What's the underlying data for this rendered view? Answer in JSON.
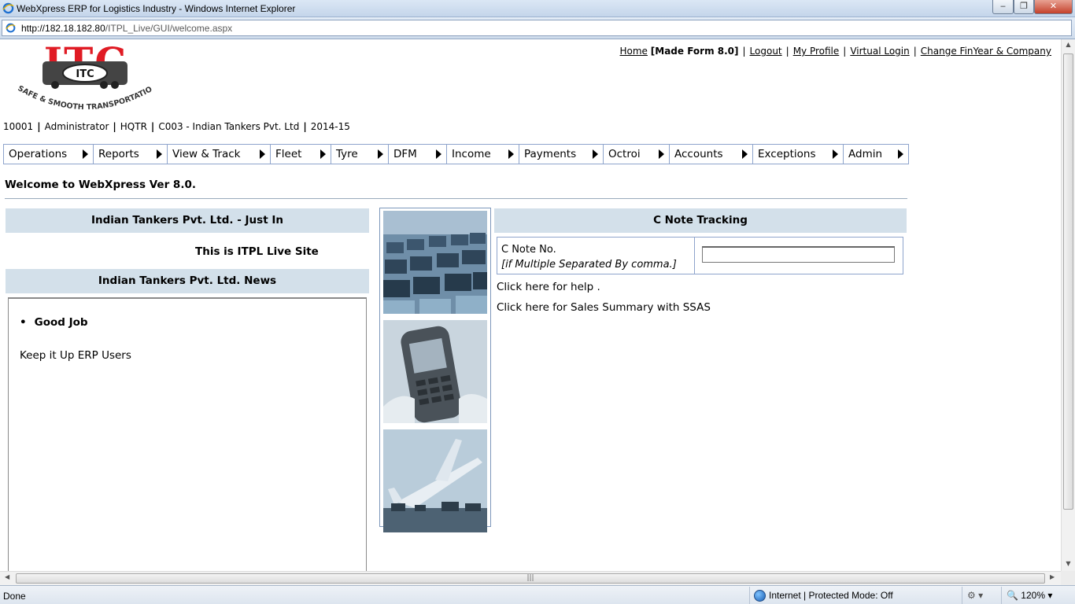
{
  "window": {
    "title": "WebXpress ERP for Logistics Industry - Windows Internet Explorer",
    "url_host": "http://182.18.182.80",
    "url_path": "/ITPL_Live/GUI/welcome.aspx"
  },
  "logo": {
    "text": "ITC",
    "tagline": "SAFE & SMOOTH TRANSPORTATION"
  },
  "header": {
    "home": "Home",
    "form_version": "[Made Form 8.0]",
    "logout": "Logout",
    "my_profile": "My Profile",
    "virtual_login": "Virtual Login",
    "change_finyear": "Change FinYear & Company"
  },
  "user_info": {
    "id": "10001",
    "role": "Administrator",
    "location": "HQTR",
    "company": "C003 - Indian Tankers Pvt. Ltd",
    "fin_year": "2014-15"
  },
  "menu": [
    {
      "label": "Operations"
    },
    {
      "label": "Reports"
    },
    {
      "label": "View & Track"
    },
    {
      "label": "Fleet"
    },
    {
      "label": "Tyre"
    },
    {
      "label": "DFM"
    },
    {
      "label": "Income"
    },
    {
      "label": "Payments"
    },
    {
      "label": "Octroi"
    },
    {
      "label": "Accounts"
    },
    {
      "label": "Exceptions"
    },
    {
      "label": "Admin"
    }
  ],
  "welcome": "Welcome to WebXpress Ver 8.0.",
  "just_in": {
    "title": "Indian Tankers Pvt. Ltd. - Just In",
    "text": "This is ITPL Live Site"
  },
  "news": {
    "title": "Indian Tankers Pvt. Ltd. News",
    "headline": "Good Job",
    "body": "Keep it Up ERP Users"
  },
  "cnote": {
    "title": "C Note Tracking",
    "label": "C Note No.",
    "hint": "[if Multiple Separated By comma.]",
    "value": ""
  },
  "links": {
    "help": "Click here for help .",
    "sales": "Click here for Sales Summary with SSAS"
  },
  "status": {
    "left": "Done",
    "zone": "Internet | Protected Mode: Off",
    "zoom": "120%"
  }
}
